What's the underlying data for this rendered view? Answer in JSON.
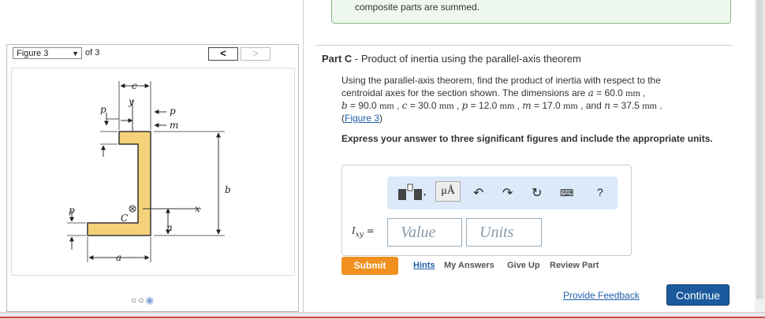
{
  "top_notice": "composite parts are summed.",
  "figure_nav": {
    "selected": "Figure 3",
    "of_label": "of 3",
    "prev": "<",
    "next": ">"
  },
  "figure_labels": {
    "c": "c",
    "y": "y",
    "p_top_left": "p",
    "p_top_right": "p",
    "m": "m",
    "b": "b",
    "p_left": "p",
    "C": "C",
    "x": "x",
    "n": "n",
    "a": "a"
  },
  "part": {
    "prefix": "Part C",
    "separator": " - ",
    "title": "Product of inertia using the parallel-axis theorem"
  },
  "description": {
    "line1": "Using the parallel-axis theorem, find the product of inertia with respect to the",
    "line2": "centroidal axes for the section shown. The dimensions are",
    "a_sym": "a",
    "a_val": " = 60.0 ",
    "mm": "mm",
    "b_sym": "b",
    "b_val": " = 90.0 ",
    "c_sym": "c",
    "c_val": " = 30.0 ",
    "p_sym": "p",
    "p_val": " = 12.0 ",
    "m_sym": "m",
    "m_val": " = 17.0 ",
    "and": " and ",
    "n_sym": "n",
    "n_val": " = 37.5 ",
    "figure_link": "Figure 3"
  },
  "instructions": "Express your answer to three significant figures and include the appropriate units.",
  "toolbar": {
    "mu_label": "μÅ",
    "help": "?"
  },
  "answer": {
    "label_main": "I",
    "label_sub": "xy",
    "label_eq": " =",
    "value_placeholder": "Value",
    "units_placeholder": "Units"
  },
  "actions": {
    "submit": "Submit",
    "hints": "Hints",
    "my_answers": "My Answers",
    "give_up": "Give Up",
    "review_part": "Review Part",
    "provide_feedback": "Provide Feedback",
    "continue": "Continue"
  },
  "colors": {
    "section_fill": "#f5d27a",
    "section_stroke": "#333333",
    "submit": "#f0901f",
    "continue": "#1c5a9e",
    "link": "#1f5fa8",
    "toolbar_bg": "#dbe9f8"
  }
}
